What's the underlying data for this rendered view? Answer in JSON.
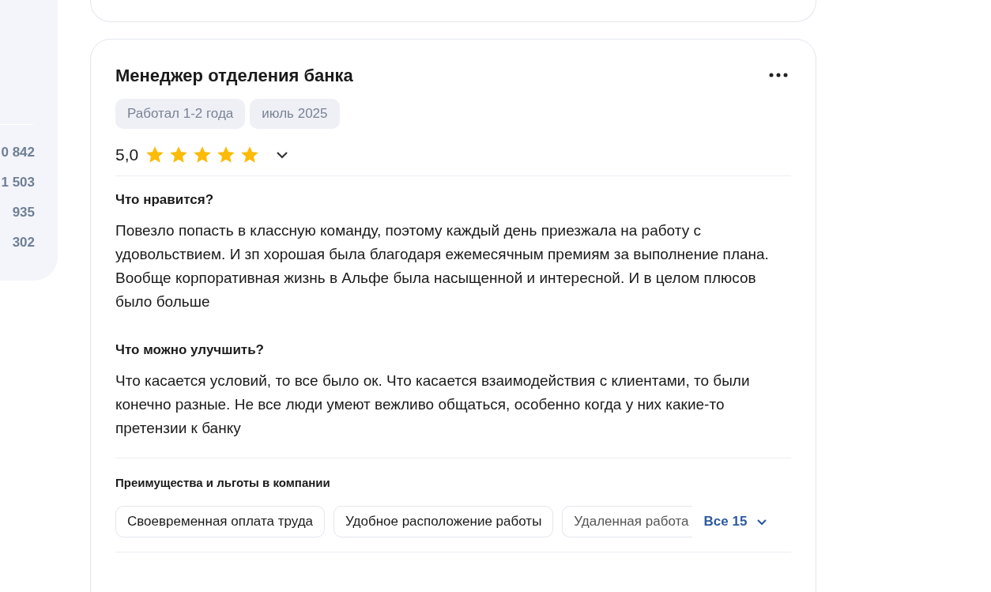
{
  "sidebar": {
    "counts": [
      "0 842",
      "1 503",
      "935",
      "302"
    ]
  },
  "review": {
    "title": "Менеджер отделения банка",
    "tags": [
      "Работал 1-2 года",
      "июль 2025"
    ],
    "rating": "5,0",
    "stars": 5,
    "sections": [
      {
        "heading": "Что нравится?",
        "text": "Повезло попасть в классную команду, поэтому каждый день приезжала на работу с удовольствием. И зп хорошая была благодаря ежемесячным премиям за выполнение плана. Вообще корпоративная жизнь в Альфе была насыщенной и интересной. И в целом плюсов было больше"
      },
      {
        "heading": "Что можно улучшить?",
        "text": "Что касается условий, то все было ок. Что касается взаимодействия с клиентами, то были конечно разные. Не все люди умеют вежливо общаться, особенно когда у них какие-то претензии к банку"
      }
    ],
    "benefits": {
      "heading": "Преимущества и льготы в компании",
      "items": [
        "Своевременная оплата труда",
        "Удобное расположение работы",
        "Удаленная работа"
      ],
      "more": "Все 15"
    }
  }
}
